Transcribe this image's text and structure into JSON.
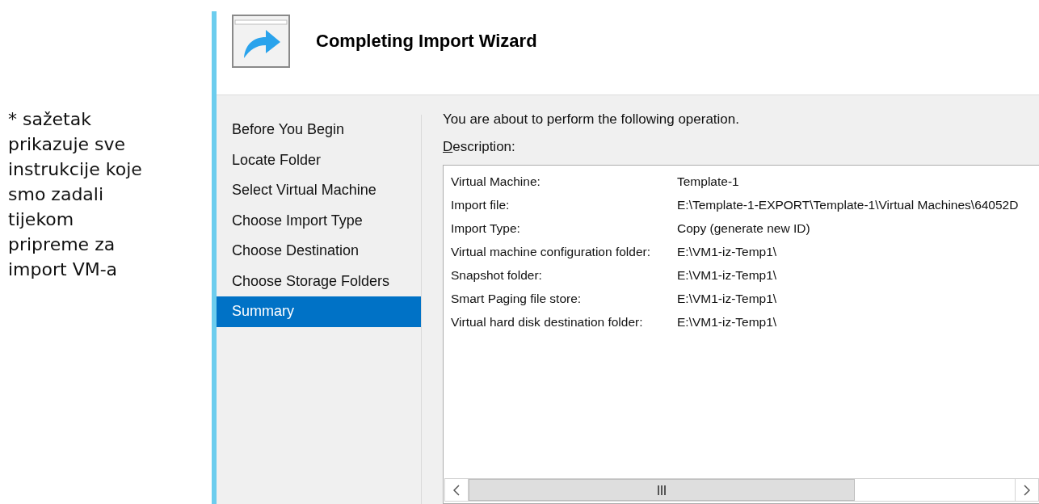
{
  "note": "*  sažetak\nprikazuje sve\ninstrukcije koje\nsmo zadali\ntijekom\npripreme za\nimport VM-a",
  "window": {
    "title": "Completing Import Wizard"
  },
  "steps": [
    {
      "label": "Before You Begin",
      "selected": false
    },
    {
      "label": "Locate Folder",
      "selected": false
    },
    {
      "label": "Select Virtual Machine",
      "selected": false
    },
    {
      "label": "Choose Import Type",
      "selected": false
    },
    {
      "label": "Choose Destination",
      "selected": false
    },
    {
      "label": "Choose Storage Folders",
      "selected": false
    },
    {
      "label": "Summary",
      "selected": true
    }
  ],
  "intro": "You are about to perform the following operation.",
  "description_label": "Description:",
  "summary": [
    {
      "name": "Virtual Machine:",
      "value": "Template-1"
    },
    {
      "name": "Import file:",
      "value": "E:\\Template-1-EXPORT\\Template-1\\Virtual Machines\\64052D"
    },
    {
      "name": "Import Type:",
      "value": "Copy (generate new ID)"
    },
    {
      "name": "Virtual machine configuration folder:",
      "value": "E:\\VM1-iz-Temp1\\"
    },
    {
      "name": "Snapshot folder:",
      "value": "E:\\VM1-iz-Temp1\\"
    },
    {
      "name": "Smart Paging file store:",
      "value": "E:\\VM1-iz-Temp1\\"
    },
    {
      "name": "Virtual hard disk destination folder:",
      "value": "E:\\VM1-iz-Temp1\\"
    }
  ]
}
